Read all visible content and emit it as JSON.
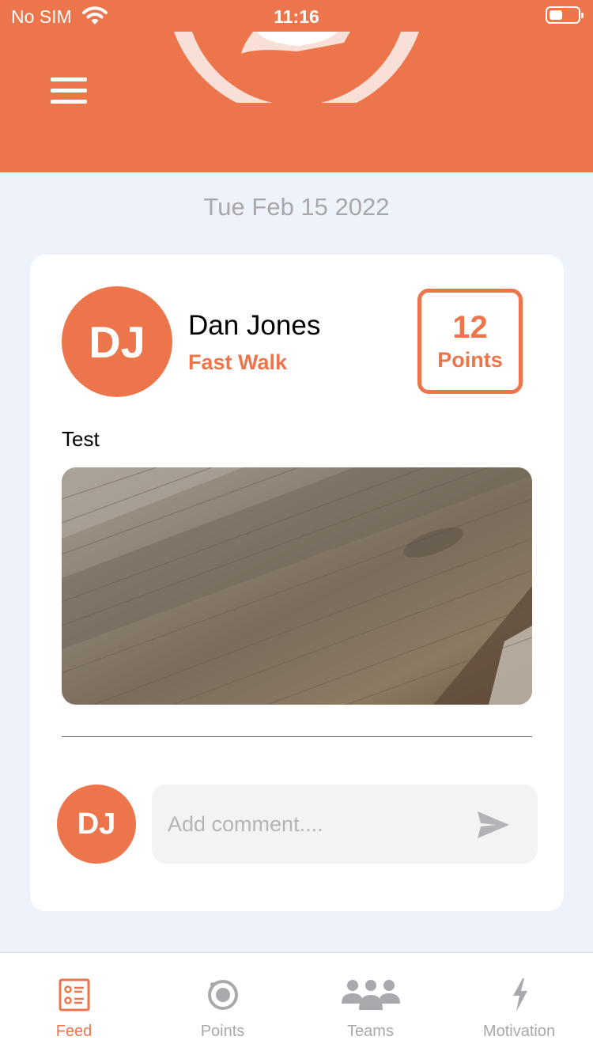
{
  "status_bar": {
    "carrier": "No SIM",
    "time": "11:16"
  },
  "colors": {
    "accent": "#ec754b",
    "background": "#eef2fa",
    "inactive": "#a9a9ad"
  },
  "header": {
    "menu_icon": "hamburger-menu-icon",
    "logo": "app-logo"
  },
  "feed": {
    "date": "Tue Feb 15 2022"
  },
  "post": {
    "avatar_initials": "DJ",
    "user_name": "Dan Jones",
    "activity": "Fast Walk",
    "points_value": "12",
    "points_unit": "Points",
    "text": "Test",
    "image": "wooden-surface-photo"
  },
  "comment": {
    "avatar_initials": "DJ",
    "placeholder": "Add comment....",
    "send_icon": "send-icon"
  },
  "tab_bar": {
    "tabs": [
      {
        "label": "Feed",
        "icon": "feed-list-icon",
        "active": true
      },
      {
        "label": "Points",
        "icon": "points-target-icon",
        "active": false
      },
      {
        "label": "Teams",
        "icon": "teams-people-icon",
        "active": false
      },
      {
        "label": "Motivation",
        "icon": "lightning-bolt-icon",
        "active": false
      }
    ]
  }
}
